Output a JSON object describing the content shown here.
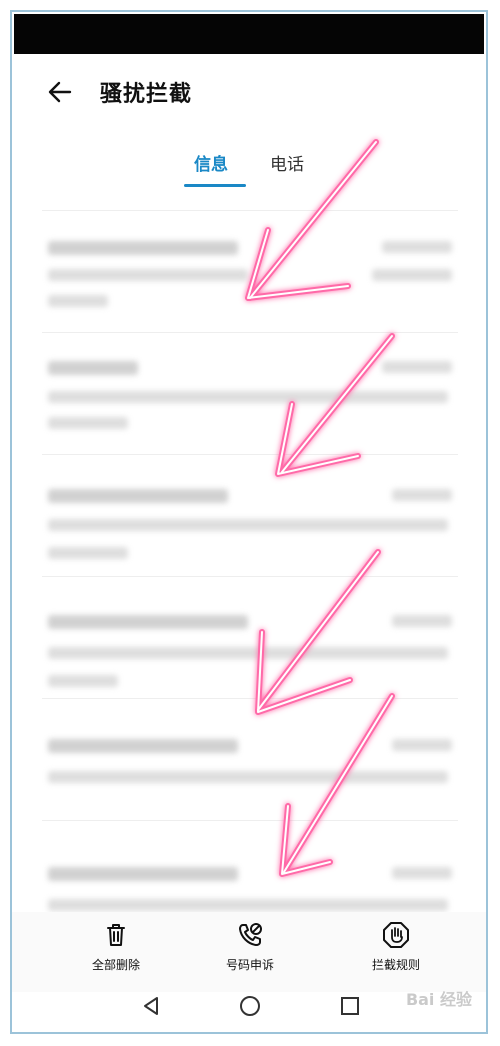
{
  "app": {
    "title": "骚扰拦截"
  },
  "tabs": [
    {
      "label": "信息",
      "active": true
    },
    {
      "label": "电话",
      "active": false
    }
  ],
  "actions": [
    {
      "label": "全部删除",
      "icon": "trash-icon"
    },
    {
      "label": "号码申诉",
      "icon": "phone-appeal-icon"
    },
    {
      "label": "拦截规则",
      "icon": "hand-shield-icon"
    }
  ],
  "nav": [
    {
      "icon": "back-triangle-icon"
    },
    {
      "icon": "home-circle-icon"
    },
    {
      "icon": "recents-square-icon"
    }
  ],
  "watermark": {
    "text": "Bai 经验"
  },
  "colors": {
    "accent": "#1a88c6",
    "arrow": "#ff6aa8"
  }
}
